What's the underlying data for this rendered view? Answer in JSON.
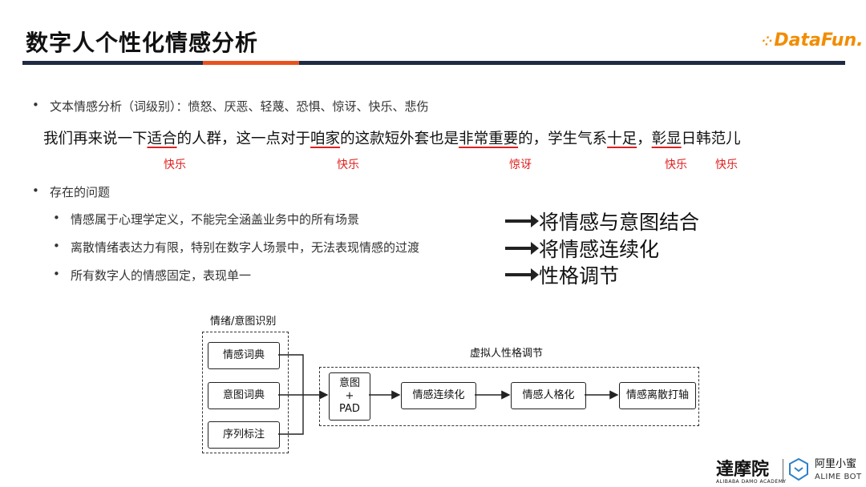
{
  "header": {
    "title": "数字人个性化情感分析",
    "logo": "DataFun."
  },
  "bullets": {
    "b1": "文本情感分析（词级别）：愤怒、厌恶、轻蔑、恐惧、惊讶、快乐、悲伤",
    "b2": "存在的问题",
    "sub": [
      "情感属于心理学定义，不能完全涵盖业务中的所有场景",
      "离散情绪表达力有限，特别在数字人场景中，无法表现情感的过渡",
      "所有数字人的情感固定，表现单一"
    ]
  },
  "sentence": {
    "s0": "我们再来说一下",
    "u1": "适合",
    "s1": "的人群，这一点对于",
    "u2": "咱家",
    "s2": "的这款短外套也是",
    "u3": "非常重要",
    "s3": "的，学生气系",
    "u4": "十足",
    "s4": "，",
    "u5": "彰显",
    "s5": "日韩范儿",
    "labels": [
      "快乐",
      "快乐",
      "惊讶",
      "快乐",
      "快乐"
    ]
  },
  "solutions": [
    "将情感与意图结合",
    "将情感连续化",
    "性格调节"
  ],
  "diagram": {
    "left_title": "情绪/意图识别",
    "right_title": "虚拟人性格调节",
    "inputs": [
      "情感词典",
      "意图词典",
      "序列标注"
    ],
    "fusion": [
      "意图",
      "+",
      "PAD"
    ],
    "steps": [
      "情感连续化",
      "情感人格化",
      "情感离散打轴"
    ]
  },
  "footer": {
    "academy": "達摩院",
    "academy_en": "ALIBABA DAMO ACADEMY",
    "bot_cn": "阿里小蜜",
    "bot_en": "ALIME BOT"
  }
}
